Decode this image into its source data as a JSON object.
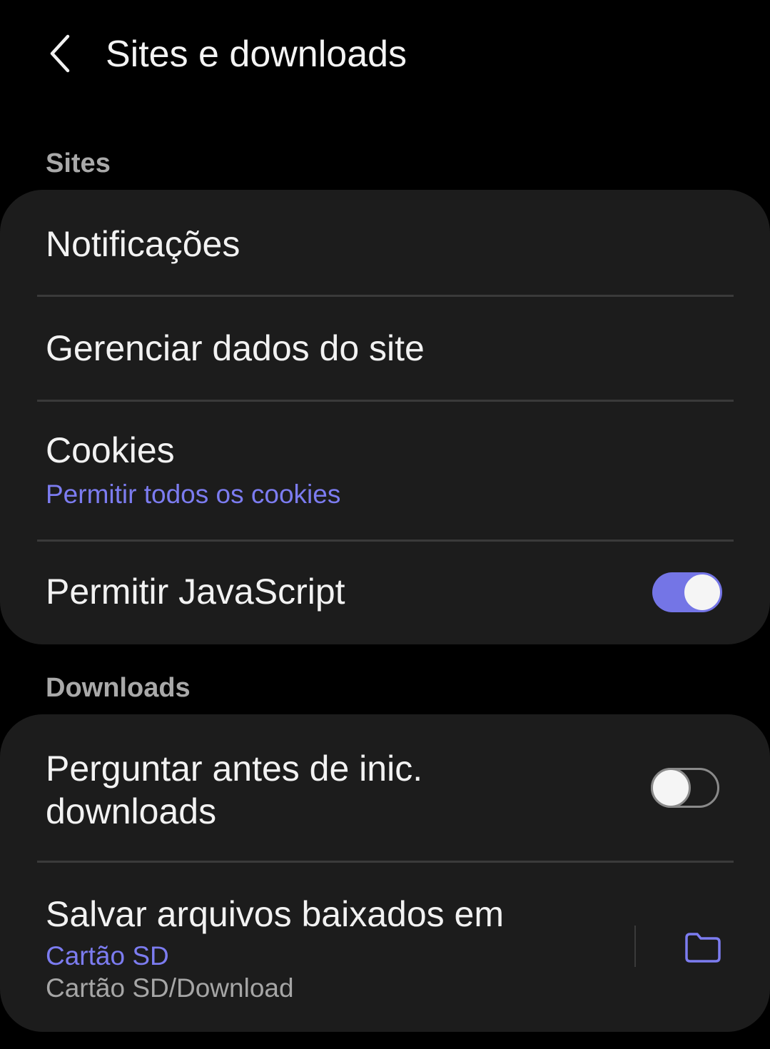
{
  "header": {
    "title": "Sites e downloads",
    "back_icon": "chevron-left-icon"
  },
  "sections": {
    "sites": {
      "label": "Sites",
      "items": {
        "notifications": {
          "title": "Notificações"
        },
        "manage_site_data": {
          "title": "Gerenciar dados do site"
        },
        "cookies": {
          "title": "Cookies",
          "subtitle": "Permitir todos os cookies"
        },
        "javascript": {
          "title": "Permitir JavaScript",
          "enabled": true
        }
      }
    },
    "downloads": {
      "label": "Downloads",
      "items": {
        "ask_before_download": {
          "title_line1": "Perguntar antes de inic.",
          "title_line2": "downloads",
          "enabled": false
        },
        "save_location": {
          "title": "Salvar arquivos baixados em",
          "location": "Cartão SD",
          "path": "Cartão SD/Download",
          "action_icon": "folder-icon"
        }
      }
    }
  },
  "colors": {
    "background": "#000000",
    "card": "#1c1c1c",
    "accent": "#7475e6",
    "accent_text": "#7c7cf0",
    "divider": "#3a3a3a",
    "section_label": "#a9a9a9"
  }
}
